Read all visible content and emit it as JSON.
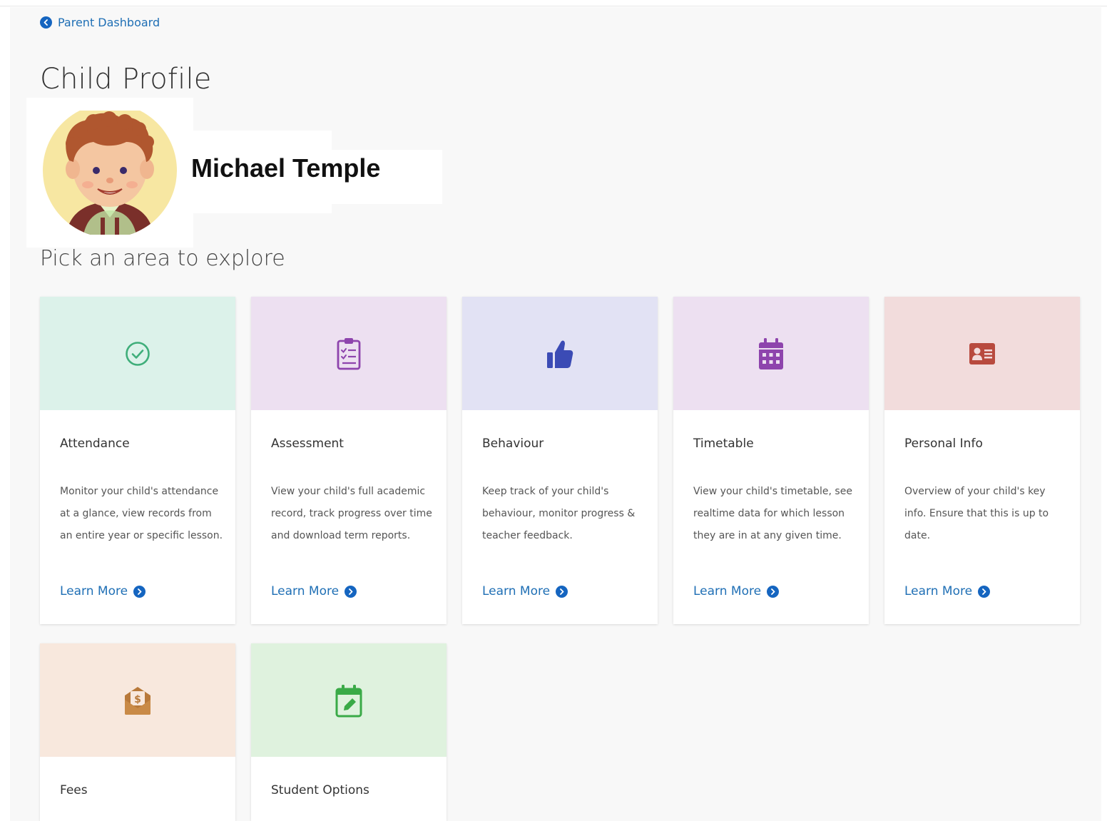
{
  "breadcrumb": {
    "label": "Parent Dashboard"
  },
  "page": {
    "title": "Child Profile",
    "section_title": "Pick an area to explore"
  },
  "child": {
    "name": "Michael Temple"
  },
  "cards": [
    {
      "title": "Attendance",
      "description": "Monitor your child's attendance at a glance, view records from an entire year or specific lesson.",
      "link": "Learn More",
      "icon": "check-circle-icon",
      "bg_color": "#dcf2ea",
      "icon_color": "#3fae7a"
    },
    {
      "title": "Assessment",
      "description": "View your child's full academic record, track progress over time and download term reports.",
      "link": "Learn More",
      "icon": "clipboard-checklist-icon",
      "bg_color": "#ede0f1",
      "icon_color": "#8e44ad"
    },
    {
      "title": "Behaviour",
      "description": "Keep track of your child's behaviour, monitor progress & teacher feedback.",
      "link": "Learn More",
      "icon": "thumbs-up-icon",
      "bg_color": "#e2e2f4",
      "icon_color": "#3b4bb5"
    },
    {
      "title": "Timetable",
      "description": "View your child's timetable, see realtime data for which lesson they are in at any given time.",
      "link": "Learn More",
      "icon": "calendar-icon",
      "bg_color": "#ede0f1",
      "icon_color": "#8e44ad"
    },
    {
      "title": "Personal Info",
      "description": "Overview of your child's key info. Ensure that this is up to date.",
      "link": "Learn More",
      "icon": "id-card-icon",
      "bg_color": "#f2dcdc",
      "icon_color": "#b84a3e"
    },
    {
      "title": "Fees",
      "description": "",
      "link": "",
      "icon": "money-envelope-icon",
      "bg_color": "#f8e8dd",
      "icon_color": "#b8793a"
    },
    {
      "title": "Student Options",
      "description": "",
      "link": "",
      "icon": "calendar-edit-icon",
      "bg_color": "#dff2de",
      "icon_color": "#3aaa47"
    }
  ]
}
